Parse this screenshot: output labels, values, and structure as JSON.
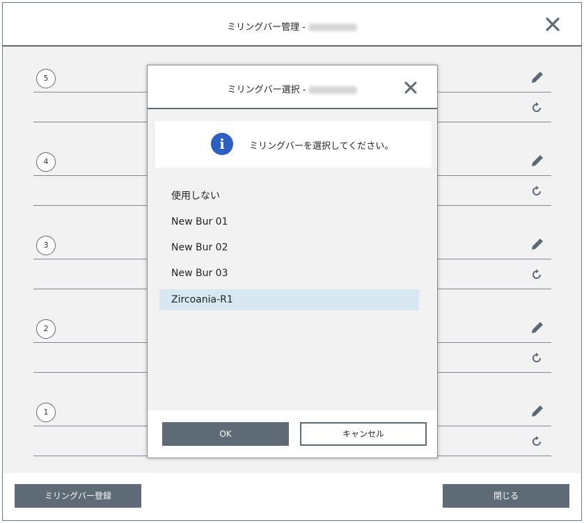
{
  "window": {
    "title": "ミリングバー管理 -",
    "close_icon": "close-icon"
  },
  "slots": [
    {
      "number": "5"
    },
    {
      "number": "4"
    },
    {
      "number": "3"
    },
    {
      "number": "2"
    },
    {
      "number": "1"
    }
  ],
  "footer": {
    "register_label": "ミリングバー登録",
    "close_label": "閉じる"
  },
  "dialog": {
    "title": "ミリングバー選択 -",
    "info_text": "ミリングバーを選択してください。",
    "items": [
      {
        "label": "使用しない"
      },
      {
        "label": "New Bur 01"
      },
      {
        "label": "New Bur 02"
      },
      {
        "label": "New Bur 03"
      },
      {
        "label": "Zircoania-R1"
      }
    ],
    "selected_index": 4,
    "ok_label": "OK",
    "cancel_label": "キャンセル"
  },
  "colors": {
    "accent_dark": "#5e6b76",
    "selection": "#d7e8f3",
    "info_blue": "#2b5fc4"
  }
}
